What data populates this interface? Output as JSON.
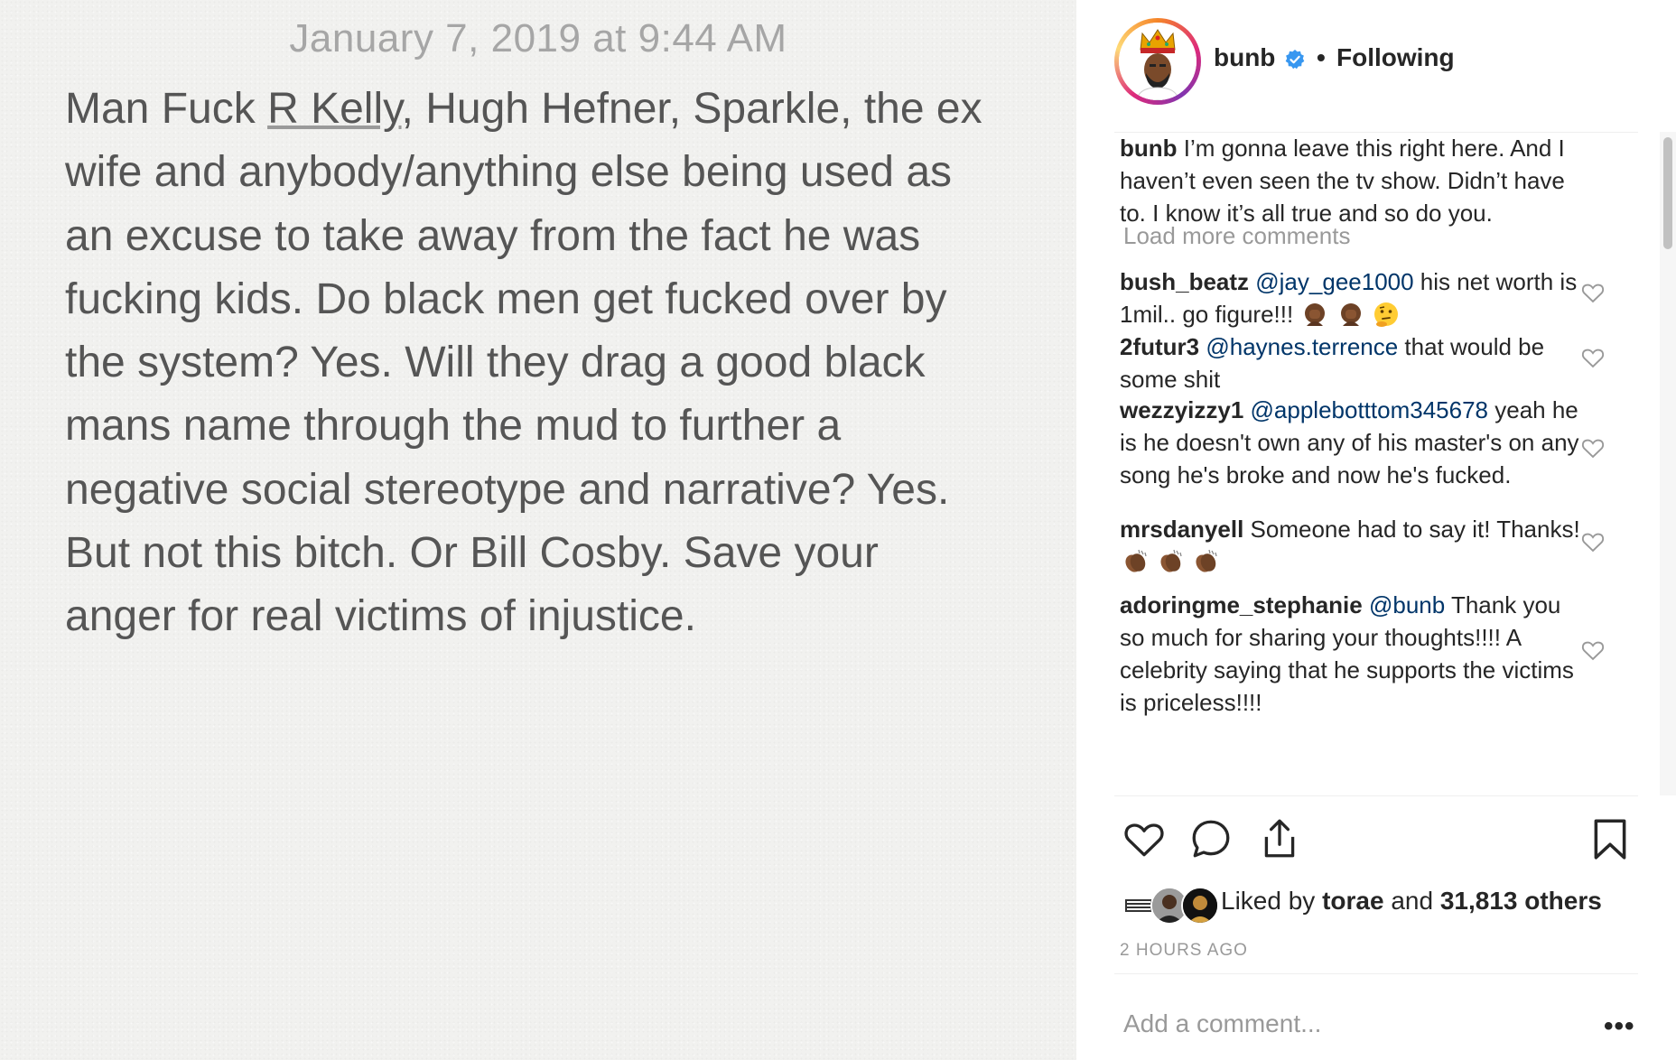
{
  "note": {
    "date": "January 7, 2019 at 9:44 AM",
    "line1_pre": "Man Fuck ",
    "line1_link": "R Kelly",
    "line1_post": ", Hugh Hefner, Sparkle, the ex",
    "lines": [
      "wife and anybody/anything else being used as",
      "an excuse to take away from the fact he was",
      "fucking kids. Do black men get fucked over by",
      "the system? Yes. Will they drag a good black",
      "mans name through the mud to further a",
      "negative social stereotype and narrative? Yes.",
      "But not this bitch. Or Bill Cosby. Save your",
      "anger for real victims of injustice."
    ]
  },
  "header": {
    "username": "bunb",
    "separator": "•",
    "follow_status": "Following"
  },
  "caption": {
    "username": "bunb",
    "text": " I’m gonna leave this right here. And I haven’t even seen the tv show. Didn’t have to. I know it’s all true and so do you."
  },
  "load_more": "Load more comments",
  "comments": [
    {
      "username": "bush_beatz",
      "mention": "@jay_gee1000",
      "text": " his net worth is 1mil.. go figure!!!",
      "emojis": [
        "facepalm-emoji",
        "facepalm-emoji",
        "thinking-emoji"
      ]
    },
    {
      "username": "2futur3",
      "mention": "@haynes.terrence",
      "text": " that would be some shit",
      "emojis": []
    },
    {
      "username": "wezzyizzy1",
      "mention": "@applebotttom345678",
      "text": " yeah he is he doesn't own any of his master's on any song he's broke and now he's fucked.",
      "emojis": []
    },
    {
      "username": "mrsdanyell",
      "mention": "",
      "text": " Someone had to say it! Thanks!",
      "emojis": [
        "clapping-emoji",
        "clapping-emoji",
        "clapping-emoji"
      ]
    },
    {
      "username": "adoringme_stephanie",
      "mention": "@bunb",
      "text": " Thank you so much for sharing your thoughts!!!! A celebrity saying that he supports the victims is priceless!!!!",
      "emojis": []
    }
  ],
  "likes": {
    "prefix": "Liked by ",
    "user": "torae",
    "middle": " and ",
    "count": "31,813 others"
  },
  "timestamp": "2 HOURS AGO",
  "add_comment_placeholder": "Add a comment...",
  "more_options": "•••",
  "colors": {
    "mention": "#003569",
    "verified": "#3897f0",
    "note_text": "#555555",
    "muted": "#999999"
  },
  "icons": {
    "like": "heart-icon",
    "comment": "comment-icon",
    "share": "share-icon",
    "save": "bookmark-icon",
    "verified": "verified-badge-icon"
  }
}
